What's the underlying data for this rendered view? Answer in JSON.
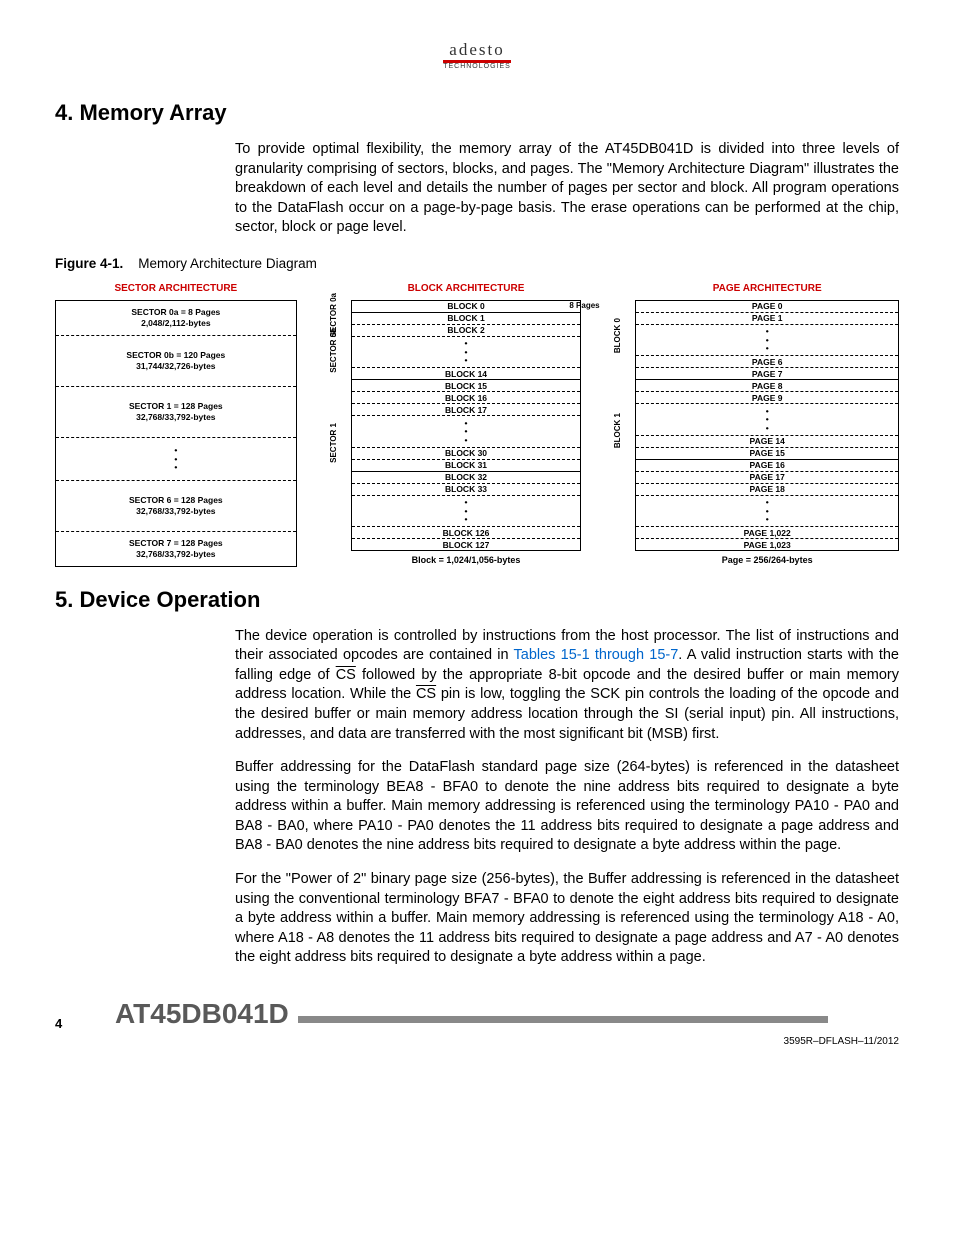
{
  "logo": {
    "brand": "adesto",
    "sub": "TECHNOLOGIES"
  },
  "section4": {
    "heading": "4.   Memory Array",
    "p1": "To provide optimal flexibility, the memory array of the AT45DB041D is divided into three levels of granularity comprising of sectors, blocks, and pages. The \"Memory Architecture Diagram\" illustrates the breakdown of each level and details the number of pages per sector and block. All program operations to the DataFlash occur on a page-by-page basis. The erase operations can be performed at the chip, sector, block or page level."
  },
  "figure": {
    "label": "Figure 4-1.",
    "title": "Memory Architecture Diagram",
    "sectorHeader": "SECTOR ARCHITECTURE",
    "blockHeader": "BLOCK ARCHITECTURE",
    "pageHeader": "PAGE ARCHITECTURE",
    "sectors": {
      "r0a": "SECTOR 0a = 8 Pages",
      "r0a2": "2,048/2,112-bytes",
      "r0b": "SECTOR 0b = 120 Pages",
      "r0b2": "31,744/32,726-bytes",
      "r1": "SECTOR 1 = 128 Pages",
      "r12": "32,768/33,792-bytes",
      "r6": "SECTOR 6 = 128 Pages",
      "r62": "32,768/33,792-bytes",
      "r7": "SECTOR 7 = 128 Pages",
      "r72": "32,768/33,792-bytes"
    },
    "blockSide0a": "SECTOR 0a",
    "blockSide0b": "SECTOR 0b",
    "blockSide1": "SECTOR 1",
    "blocks": {
      "b0": "BLOCK 0",
      "b1": "BLOCK 1",
      "b2": "BLOCK 2",
      "b14": "BLOCK 14",
      "b15": "BLOCK 15",
      "b16": "BLOCK 16",
      "b17": "BLOCK 17",
      "b30": "BLOCK 30",
      "b31": "BLOCK 31",
      "b32": "BLOCK 32",
      "b33": "BLOCK 33",
      "b126": "BLOCK 126",
      "b127": "BLOCK 127"
    },
    "blockFooter": "Block = 1,024/1,056-bytes",
    "eightPages": "8 Pages",
    "pageSideB0": "BLOCK 0",
    "pageSideB1": "BLOCK 1",
    "pages": {
      "p0": "PAGE 0",
      "p1": "PAGE 1",
      "p6": "PAGE 6",
      "p7": "PAGE 7",
      "p8": "PAGE 8",
      "p9": "PAGE 9",
      "p14": "PAGE 14",
      "p15": "PAGE 15",
      "p16": "PAGE 16",
      "p17": "PAGE 17",
      "p18": "PAGE 18",
      "p1022": "PAGE 1,022",
      "p1023": "PAGE 1,023"
    },
    "pageFooter": "Page = 256/264-bytes"
  },
  "section5": {
    "heading": "5.   Device Operation",
    "p1a": "The device operation is controlled by instructions from the host processor. The list of instructions and their associated opcodes are contained in ",
    "p1link": "Tables 15-1 through 15-7",
    "p1b": ". A valid instruction starts with the falling edge of ",
    "p1cs1": "CS",
    "p1c": " followed by the appropriate 8-bit opcode and the desired buffer or main memory address location. While the ",
    "p1cs2": "CS",
    "p1d": " pin is low, toggling the SCK pin controls the loading of the opcode and the desired buffer or main memory address location through the SI (serial input) pin. All instructions, addresses, and data are transferred with the most significant bit (MSB) first.",
    "p2": "Buffer addressing for the DataFlash standard page size (264-bytes) is referenced in the datasheet using the terminology BEA8 - BFA0 to denote the nine address bits required to designate a byte address within a buffer. Main memory addressing is referenced using the terminology PA10 - PA0 and BA8 - BA0, where PA10 - PA0 denotes the 11 address bits required to designate a page address and BA8 - BA0 denotes the nine address bits required to designate a byte address within the page.",
    "p3": "For the \"Power of 2\" binary page size (256-bytes), the Buffer addressing is referenced in the datasheet using the conventional terminology BFA7 - BFA0 to denote the eight address bits required to designate a byte address within a buffer. Main memory addressing is referenced using the terminology A18 - A0, where A18 - A8 denotes the 11 address bits required to designate a page address and A7 - A0 denotes the eight address bits required to designate a byte address within a page."
  },
  "footer": {
    "pageNum": "4",
    "partNum": "AT45DB041D",
    "docId": "3595R–DFLASH–11/2012"
  }
}
